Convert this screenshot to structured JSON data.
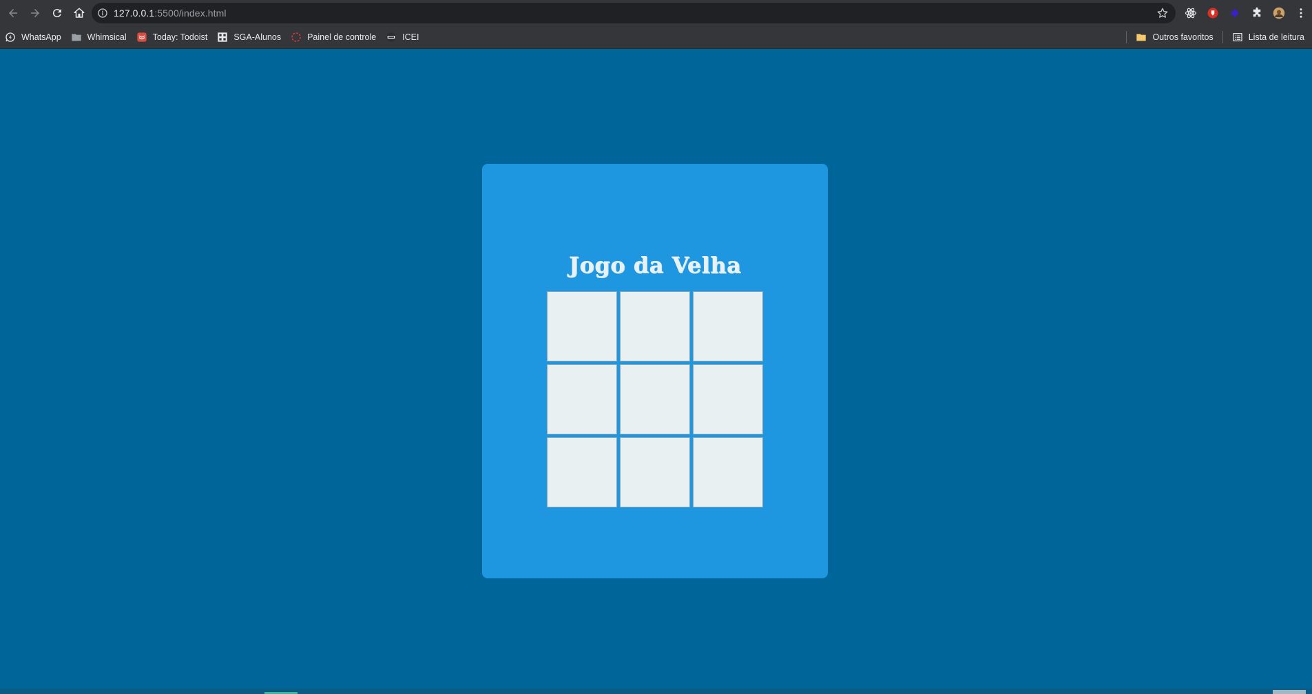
{
  "browser": {
    "url_host": "127.0.0.1",
    "url_rest": ":5500/index.html",
    "bookmarks": [
      {
        "label": "WhatsApp",
        "icon": "whatsapp-icon"
      },
      {
        "label": "Whimsical",
        "icon": "folder-icon"
      },
      {
        "label": "Today: Todoist",
        "icon": "todoist-icon"
      },
      {
        "label": "SGA-Alunos",
        "icon": "sga-icon"
      },
      {
        "label": "Painel de controle",
        "icon": "dashed-circle-icon"
      },
      {
        "label": "ICEI",
        "icon": "icei-icon"
      }
    ],
    "other_bookmarks": "Outros favoritos",
    "reading_list": "Lista de leitura"
  },
  "game": {
    "title": "Jogo da Velha",
    "cells": [
      "",
      "",
      "",
      "",
      "",
      "",
      "",
      "",
      ""
    ]
  },
  "colors": {
    "page_background": "#006699",
    "card_background": "#1e96e0",
    "cell_background": "#e8f0f1",
    "title_color": "#e8f2f5"
  }
}
